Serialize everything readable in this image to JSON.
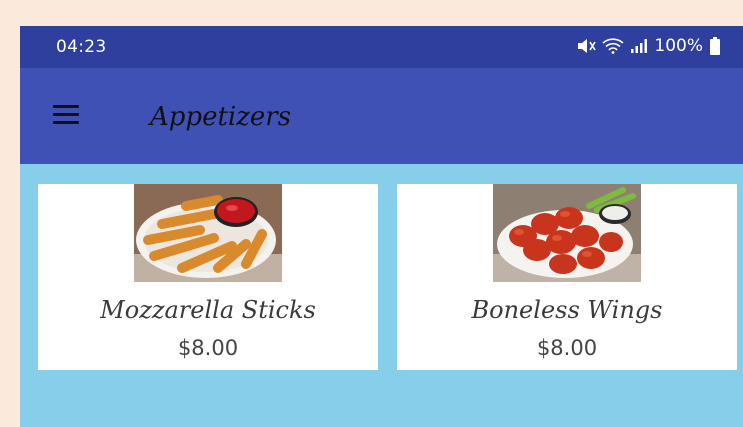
{
  "status_bar": {
    "time": "04:23",
    "battery": "100%",
    "icons": [
      "mute-icon",
      "wifi-icon",
      "signal-icon",
      "battery-icon"
    ]
  },
  "app_bar": {
    "menu_icon": "hamburger-menu-icon",
    "title": "Appetizers"
  },
  "items": [
    {
      "name": "Mozzarella Sticks",
      "price": "$8.00",
      "image": "mozzarella-sticks-photo"
    },
    {
      "name": "Boneless Wings",
      "price": "$8.00",
      "image": "boneless-wings-photo"
    }
  ],
  "colors": {
    "status_bar": "#2f3f9d",
    "app_bar": "#3f51b5",
    "content_bg": "#87ceeb",
    "page_bg": "#fbeadb"
  }
}
